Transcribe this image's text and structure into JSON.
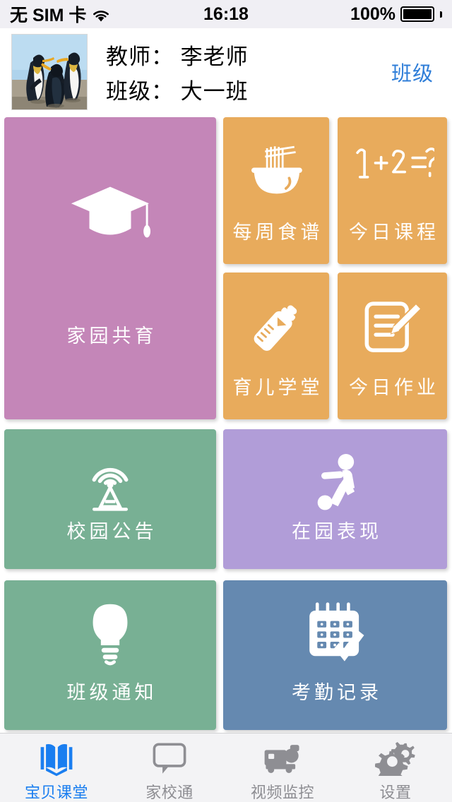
{
  "statusbar": {
    "carrier": "无 SIM 卡",
    "wifi_icon": "wifi-icon",
    "time": "16:18",
    "battery_percent": "100%",
    "battery_icon": "battery-full-icon"
  },
  "header": {
    "avatar_alt": "penguins-photo",
    "teacher_line": "教师： 李老师",
    "class_line": "班级： 大一班",
    "class_button": "班级",
    "accent_color": "#2f7ed8"
  },
  "tiles": [
    {
      "id": "jygy",
      "label": "家园共育",
      "icon": "graduation-cap-icon",
      "color": "#c486b8"
    },
    {
      "id": "mzsp",
      "label": "每周食谱",
      "icon": "noodle-bowl-icon",
      "color": "#e8ab5c"
    },
    {
      "id": "jrkc",
      "label": "今日课程",
      "icon": "math-equation-icon",
      "color": "#e8ab5c"
    },
    {
      "id": "yext",
      "label": "育儿学堂",
      "icon": "baby-bottle-icon",
      "color": "#e8ab5c"
    },
    {
      "id": "jrzy",
      "label": "今日作业",
      "icon": "notepad-pencil-icon",
      "color": "#e8ab5c"
    },
    {
      "id": "xygg",
      "label": "校园公告",
      "icon": "broadcast-tower-icon",
      "color": "#78b094"
    },
    {
      "id": "zybx",
      "label": "在园表现",
      "icon": "person-kicking-ball-icon",
      "color": "#b19dd8"
    },
    {
      "id": "bjtz",
      "label": "班级通知",
      "icon": "lightbulb-icon",
      "color": "#78b094"
    },
    {
      "id": "kqjl",
      "label": "考勤记录",
      "icon": "calendar-check-icon",
      "color": "#6589b0"
    }
  ],
  "tabbar": {
    "active_color": "#1a7ef0",
    "inactive_color": "#8e8e93",
    "items": [
      {
        "label": "宝贝课堂",
        "icon": "open-book-icon",
        "active": true
      },
      {
        "label": "家校通",
        "icon": "chat-bubble-icon",
        "active": false
      },
      {
        "label": "视频监控",
        "icon": "video-camera-icon",
        "active": false
      },
      {
        "label": "设置",
        "icon": "gears-icon",
        "active": false
      }
    ]
  },
  "math_icon_text": "1+2=?"
}
